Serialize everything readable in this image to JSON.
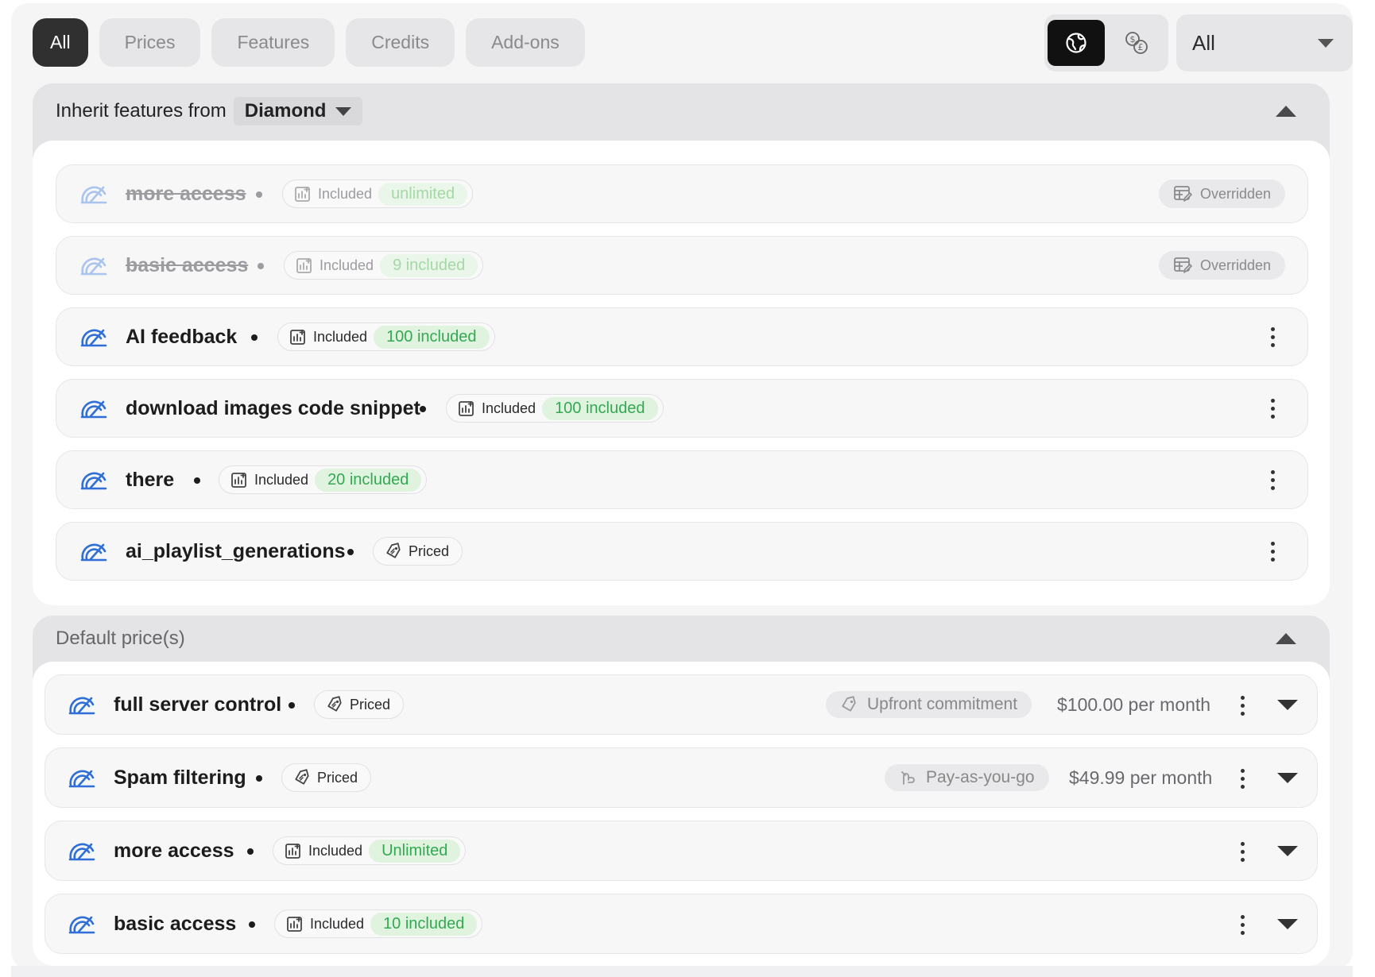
{
  "tabs": [
    {
      "label": "All",
      "active": true
    },
    {
      "label": "Prices",
      "active": false
    },
    {
      "label": "Features",
      "active": false
    },
    {
      "label": "Credits",
      "active": false
    },
    {
      "label": "Add-ons",
      "active": false
    }
  ],
  "currency_mode": {
    "options": [
      "globe-icon",
      "multi-currency-icon"
    ],
    "selected": "globe-icon"
  },
  "filter_select": {
    "value": "All"
  },
  "inherit_section": {
    "label": "Inherit features from",
    "plan": "Diamond",
    "features": [
      {
        "name": "more access",
        "status": "Included",
        "amount": "unlimited",
        "overridden": true,
        "badge": "Overridden"
      },
      {
        "name": "basic access",
        "status": "Included",
        "amount": "9 included",
        "overridden": true,
        "badge": "Overridden"
      },
      {
        "name": "AI feedback",
        "status": "Included",
        "amount": "100 included",
        "overridden": false
      },
      {
        "name": "download images code snippet",
        "status": "Included",
        "amount": "100 included",
        "overridden": false
      },
      {
        "name": "there",
        "status": "Included",
        "amount": "20 included",
        "overridden": false
      },
      {
        "name": "ai_playlist_generations",
        "status": "Priced",
        "amount": null,
        "overridden": false
      }
    ]
  },
  "default_section": {
    "title": "Default price(s)",
    "items": [
      {
        "name": "full server control",
        "status": "Priced",
        "commitment": "Upfront commitment",
        "price": "$100.00 per month"
      },
      {
        "name": "Spam filtering",
        "status": "Priced",
        "commitment": "Pay-as-you-go",
        "price": "$49.99 per month"
      },
      {
        "name": "more access",
        "status": "Included",
        "amount": "Unlimited"
      },
      {
        "name": "basic access",
        "status": "Included",
        "amount": "10 included"
      }
    ]
  },
  "colors": {
    "accent_blue": "#2f6fd6",
    "included_green": "#34a853",
    "active_tab": "#303031"
  }
}
